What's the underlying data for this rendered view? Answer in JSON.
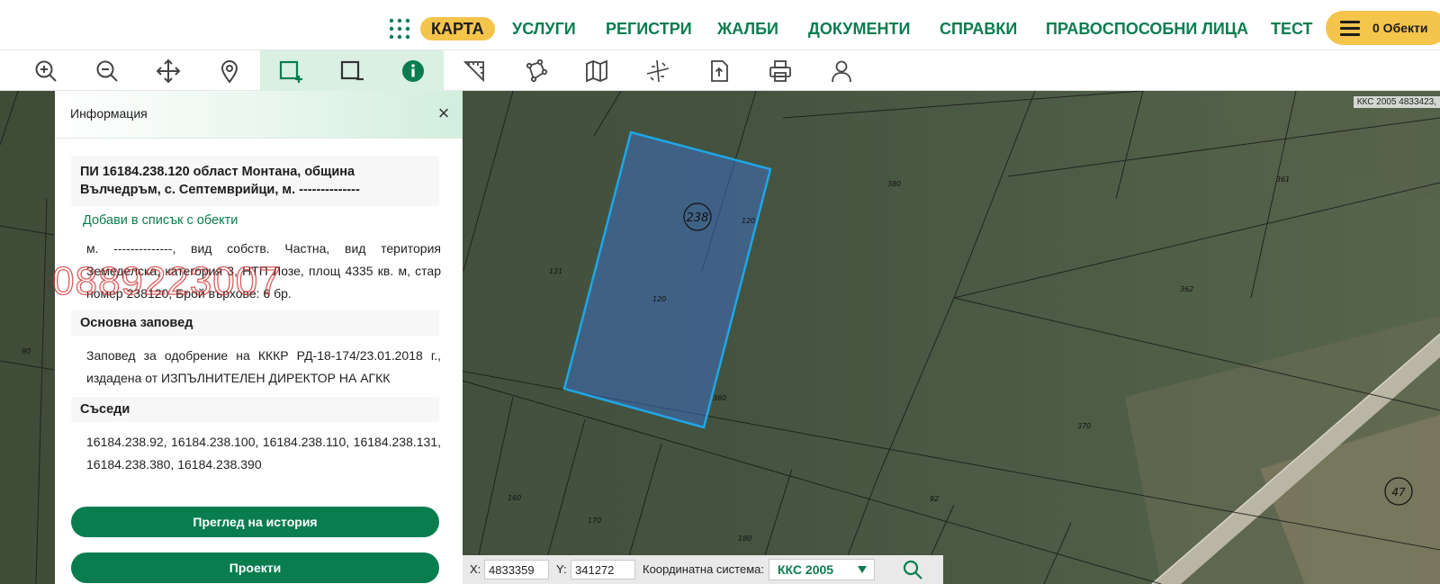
{
  "nav": {
    "items": [
      "КАРТА",
      "УСЛУГИ",
      "РЕГИСТРИ",
      "ЖАЛБИ",
      "ДОКУМЕНТИ",
      "СПРАВКИ",
      "ПРАВОСПОСОБНИ ЛИЦА",
      "ТЕСТ"
    ],
    "active": "КАРТА",
    "objects_label": "0 Обекти"
  },
  "toolbar": {
    "tools": [
      "zoom-in-icon",
      "zoom-out-icon",
      "pan-icon",
      "location-pin-icon",
      "select-add-icon",
      "select-remove-icon",
      "info-icon",
      "measure-icon",
      "polygon-icon",
      "map-layers-icon",
      "cross-section-icon",
      "export-document-icon",
      "print-icon",
      "user-icon"
    ],
    "active": [
      "select-add-icon",
      "info-icon"
    ]
  },
  "panel": {
    "title": "Информация",
    "close_label": "×",
    "parcel_title": "ПИ 16184.238.120 област Монтана, община Вълчедръм, с. Септемврийци, м. --------------",
    "add_to_list": "Добави в списък с обекти",
    "description": "м. --------------, вид собств. Частна, вид територия Земеделска, категория 3, НТП Лозе, площ 4335 кв. м, стар номер 238120, Брой върхове: 6 бр.",
    "order_heading": "Основна заповед",
    "order_text": "Заповед за одобрение на КККР РД-18-174/23.01.2018 г., издадена от ИЗПЪЛНИТЕЛЕН ДИРЕКТОР НА АГКК",
    "neighbors_heading": "Съседи",
    "neighbors_text": "16184.238.92, 16184.238.100, 16184.238.110, 16184.238.131, 16184.238.380, 16184.238.390",
    "history_button": "Преглед на история",
    "projects_button": "Проекти"
  },
  "watermark": "0889223007",
  "map": {
    "top_right_readout": "ККС 2005 4833423,",
    "block_label": "238",
    "road_label": "47",
    "parcel_labels": [
      "120",
      "120",
      "380",
      "380",
      "131",
      "362",
      "361",
      "370",
      "92",
      "160",
      "170",
      "180",
      "90"
    ],
    "highlight_color": "#1ea7e8"
  },
  "coords": {
    "x_label": "X:",
    "x_value": "4833359",
    "y_label": "Y:",
    "y_value": "341272",
    "system_label": "Координатна система:",
    "system_value": "ККС 2005"
  }
}
